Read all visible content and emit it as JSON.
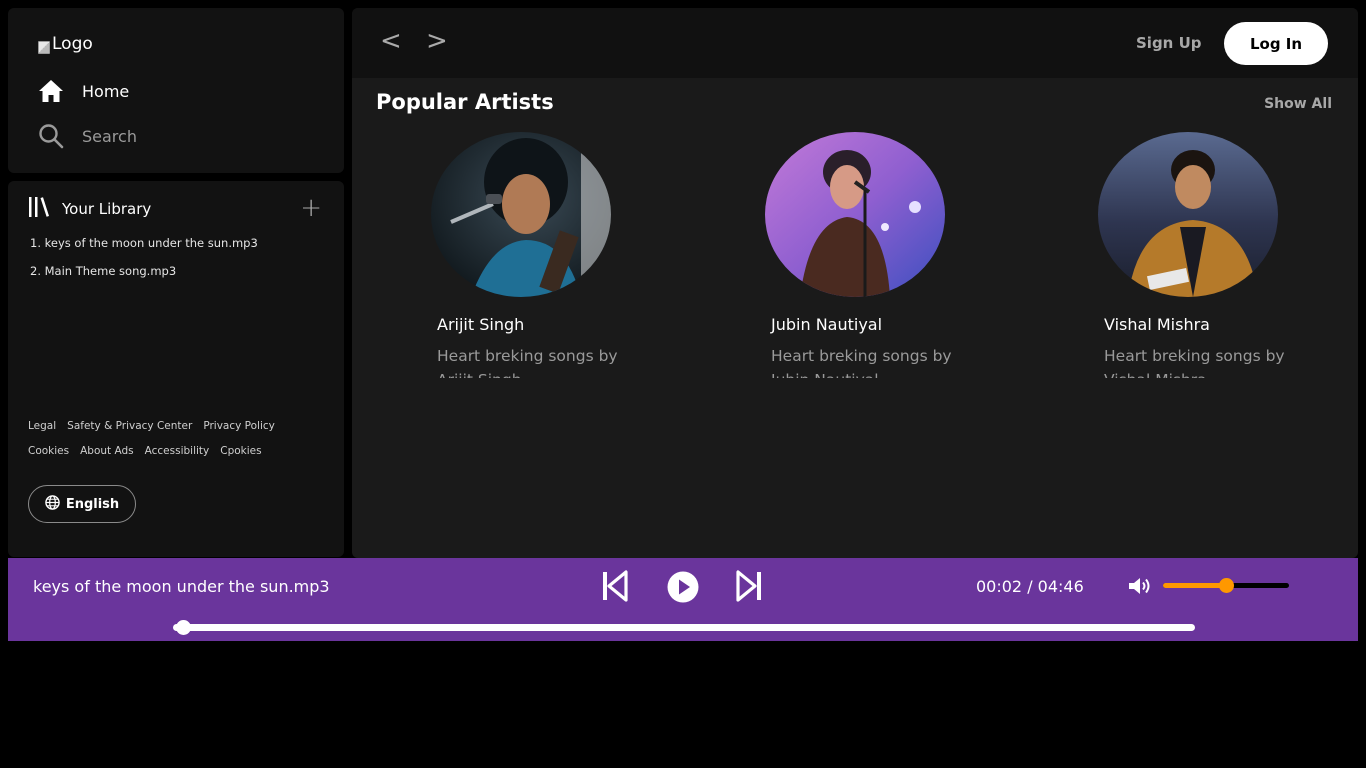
{
  "sidebar": {
    "logo_alt": "Logo",
    "nav": [
      {
        "label": "Home",
        "icon": "home-icon"
      },
      {
        "label": "Search",
        "icon": "search-icon"
      }
    ]
  },
  "library": {
    "title": "Your Library",
    "add_icon": "plus-icon",
    "items": [
      "1. keys of the moon under the sun.mp3",
      "2. Main Theme song.mp3"
    ],
    "footer_links_row1": [
      "Legal",
      "Safety & Privacy Center",
      "Privacy Policy"
    ],
    "footer_links_row2": [
      "Cookies",
      "About Ads",
      "Accessibility",
      "Cpokies"
    ],
    "language": "English"
  },
  "topbar": {
    "back": "<",
    "forward": ">",
    "signup": "Sign Up",
    "login": "Log In"
  },
  "section": {
    "title": "Popular Artists",
    "show_all": "Show All",
    "artists": [
      {
        "name": "Arijit Singh",
        "desc": "Heart breking songs by Arijit Singh"
      },
      {
        "name": "Jubin Nautiyal",
        "desc": "Heart breking songs by Jubin Nautiyal"
      },
      {
        "name": "Vishal Mishra",
        "desc": "Heart breking songs by Vishal Mishra"
      }
    ]
  },
  "player": {
    "track": "keys of the moon under the sun.mp3",
    "time": "00:02 / 04:46",
    "volume_fraction": 0.5,
    "progress_fraction": 0.01,
    "accent_color": "#6a359c",
    "volume_color": "#ff9800"
  }
}
